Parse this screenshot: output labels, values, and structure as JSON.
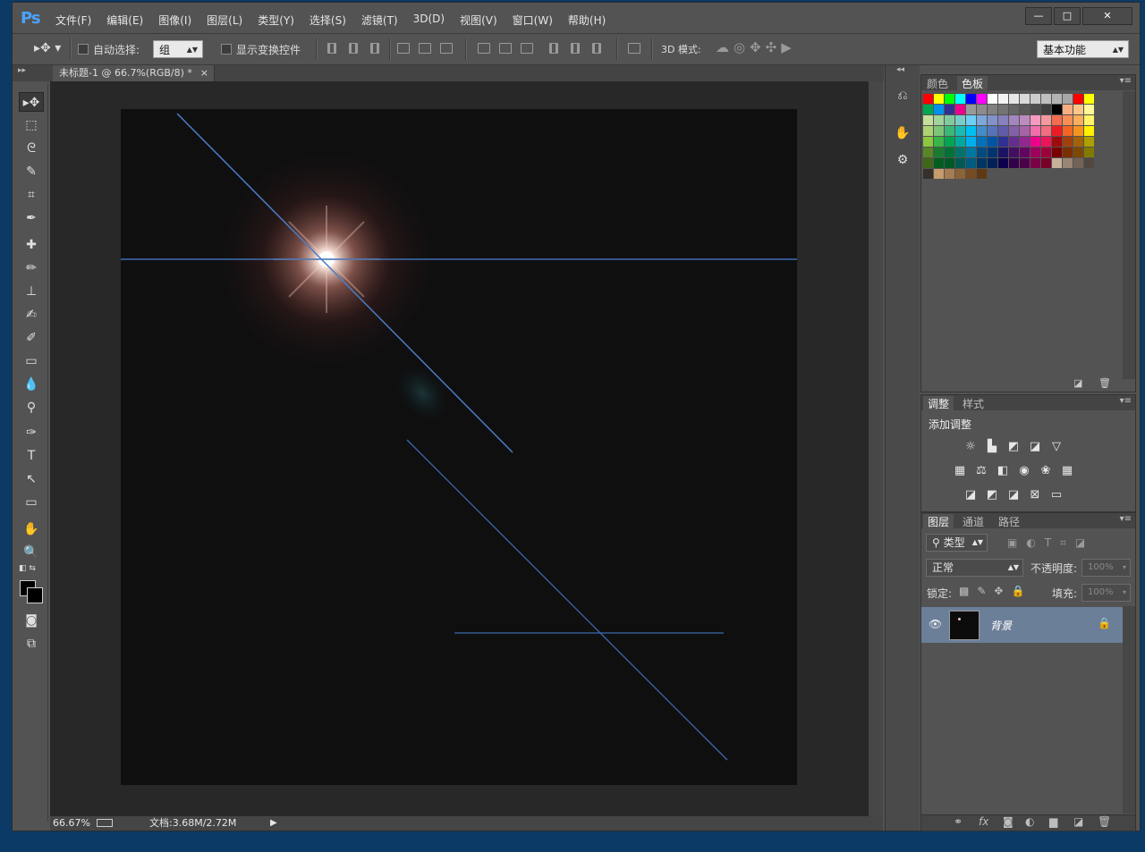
{
  "app": {
    "logo": "Ps"
  },
  "menu": [
    "文件(F)",
    "编辑(E)",
    "图像(I)",
    "图层(L)",
    "类型(Y)",
    "选择(S)",
    "滤镜(T)",
    "3D(D)",
    "视图(V)",
    "窗口(W)",
    "帮助(H)"
  ],
  "window_controls": {
    "minimize": "—",
    "maximize": "□",
    "close": "✕"
  },
  "options": {
    "auto_select_label": "自动选择:",
    "auto_select_value": "组",
    "show_transform_label": "显示变换控件",
    "mode_3d_label": "3D 模式:",
    "workspace": "基本功能"
  },
  "document_tab": {
    "title": "未标题-1 @ 66.7%(RGB/8) *",
    "close": "×"
  },
  "status": {
    "zoom": "66.67%",
    "doc": "文档:3.68M/2.72M"
  },
  "panels": {
    "color": {
      "tabs": [
        "颜色",
        "色板"
      ],
      "active": "色板"
    },
    "adjust": {
      "tabs": [
        "调整",
        "样式"
      ],
      "active": "调整",
      "heading": "添加调整"
    },
    "layers": {
      "tabs": [
        "图层",
        "通道",
        "路径"
      ],
      "active": "图层",
      "filter": "类型",
      "blend": "正常",
      "opacity_label": "不透明度:",
      "opacity": "100%",
      "lock_label": "锁定:",
      "fill_label": "填充:",
      "fill": "100%",
      "layer_name": "背景"
    }
  },
  "swatch_colors": [
    [
      "#ff0000",
      "#ffff00",
      "#00ff00",
      "#00ffff",
      "#0000ff",
      "#ff00ff",
      "#ffffff",
      "#f2f2f2",
      "#e6e6e6",
      "#d9d9d9",
      "#cccccc",
      "#bfbfbf",
      "#b3b3b3",
      "#a6a6a6",
      "#ff0000",
      "#ffff00"
    ],
    [
      "#00a651",
      "#0091ea",
      "#2e3192",
      "#ec008c",
      "#999999",
      "#8c8c8c",
      "#808080",
      "#737373",
      "#666666",
      "#595959",
      "#4d4d4d",
      "#404040",
      "#000000",
      "#f9ad81",
      "#fdc689",
      "#fff799"
    ],
    [
      "#c4df9b",
      "#a3d39c",
      "#82ca9d",
      "#7accc8",
      "#6dcff6",
      "#7da7d9",
      "#8393ca",
      "#8781bd",
      "#a187be",
      "#bd8cbf",
      "#f49ac1",
      "#f5989d",
      "#f26c4f",
      "#f68e55",
      "#fbaf5d",
      "#fff467"
    ],
    [
      "#acd372",
      "#7cc576",
      "#3bb878",
      "#1abbb4",
      "#00bff3",
      "#438ccb",
      "#5574b9",
      "#605ca8",
      "#855fa8",
      "#a763a8",
      "#f06eaa",
      "#f26d7d",
      "#ed1c24",
      "#f26522",
      "#f7941d",
      "#fff200"
    ],
    [
      "#8dc63f",
      "#39b54a",
      "#00a651",
      "#00a99d",
      "#00aeef",
      "#0072bc",
      "#0054a6",
      "#2e3192",
      "#662d91",
      "#92278f",
      "#ec008c",
      "#ed145b",
      "#9e0b0f",
      "#a0410d",
      "#a36209",
      "#aba000"
    ],
    [
      "#598527",
      "#197b30",
      "#007236",
      "#00746b",
      "#0076a3",
      "#004b80",
      "#003471",
      "#1b1464",
      "#440e62",
      "#630460",
      "#9e005d",
      "#9e0039",
      "#790000",
      "#7b2e00",
      "#7d4900",
      "#827b00"
    ],
    [
      "#406618",
      "#005e20",
      "#005826",
      "#005952",
      "#005b7f",
      "#003663",
      "#002157",
      "#0d004c",
      "#32004b",
      "#4b0049",
      "#7b0046",
      "#7a0026",
      "#c7b299",
      "#998675",
      "#736357",
      "#534741"
    ],
    [
      "#37302a",
      "#c69c6d",
      "#a67c52",
      "#8c6239",
      "#754c24",
      "#603913"
    ]
  ]
}
